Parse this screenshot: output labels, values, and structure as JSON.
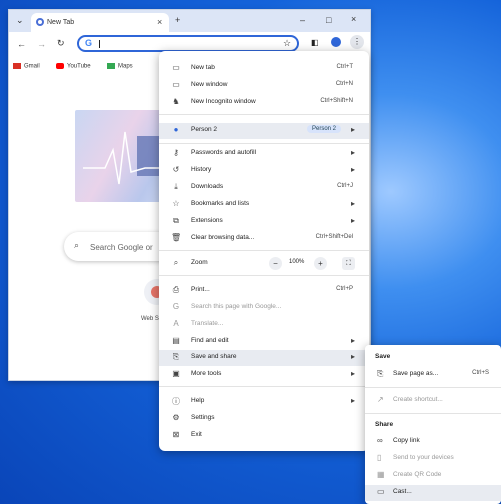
{
  "browser": {
    "tab_title": "New Tab",
    "tab_close": "×",
    "new_tab": "+",
    "tab_search": "⌄",
    "minimize": "–",
    "maximize": "□",
    "close": "×",
    "back": "←",
    "forward": "→",
    "reload": "↻",
    "omnibox_value": "",
    "bookmarks": [
      {
        "label": "Gmail",
        "color": "#d93025"
      },
      {
        "label": "YouTube",
        "color": "#ff0000"
      },
      {
        "label": "Maps",
        "color": "#34a853"
      }
    ],
    "search_placeholder": "Search Google or",
    "shortcut_label": "Web S"
  },
  "menu": {
    "new_tab": {
      "label": "New tab",
      "shortcut": "Ctrl+T"
    },
    "new_window": {
      "label": "New window",
      "shortcut": "Ctrl+N"
    },
    "new_incognito": {
      "label": "New Incognito window",
      "shortcut": "Ctrl+Shift+N"
    },
    "profile": {
      "label": "Person 2",
      "chip": "Person 2"
    },
    "passwords": {
      "label": "Passwords and autofill"
    },
    "history": {
      "label": "History"
    },
    "downloads": {
      "label": "Downloads",
      "shortcut": "Ctrl+J"
    },
    "bookmarks": {
      "label": "Bookmarks and lists"
    },
    "extensions": {
      "label": "Extensions"
    },
    "clear": {
      "label": "Clear browsing data...",
      "shortcut": "Ctrl+Shift+Del"
    },
    "zoom": {
      "label": "Zoom",
      "minus": "−",
      "value": "100%",
      "plus": "+"
    },
    "print": {
      "label": "Print...",
      "shortcut": "Ctrl+P"
    },
    "search_page": {
      "label": "Search this page with Google..."
    },
    "translate": {
      "label": "Translate..."
    },
    "find_edit": {
      "label": "Find and edit"
    },
    "save_share": {
      "label": "Save and share"
    },
    "more_tools": {
      "label": "More tools"
    },
    "help": {
      "label": "Help"
    },
    "settings": {
      "label": "Settings"
    },
    "exit": {
      "label": "Exit"
    }
  },
  "submenu": {
    "save_heading": "Save",
    "save_page": {
      "label": "Save page as...",
      "shortcut": "Ctrl+S"
    },
    "create_shortcut": {
      "label": "Create shortcut..."
    },
    "share_heading": "Share",
    "copy_link": {
      "label": "Copy link"
    },
    "send_devices": {
      "label": "Send to your devices"
    },
    "qr_code": {
      "label": "Create QR Code"
    },
    "cast": {
      "label": "Cast..."
    }
  },
  "colors": {
    "accent": "#2f66d8",
    "desktop": "#1463da"
  }
}
